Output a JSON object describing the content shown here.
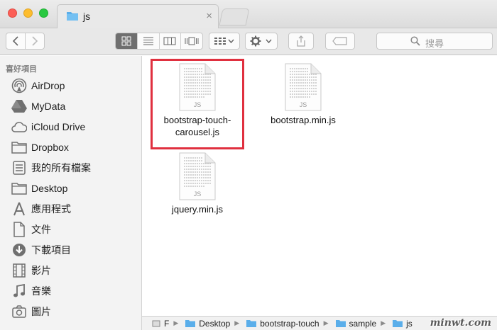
{
  "window": {
    "tab_title": "js",
    "tab_close": "×"
  },
  "toolbar": {
    "search_placeholder": "搜尋"
  },
  "sidebar": {
    "header": "喜好項目",
    "items": [
      {
        "label": "AirDrop",
        "icon": "airdrop-icon"
      },
      {
        "label": "MyData",
        "icon": "drive-icon"
      },
      {
        "label": "iCloud Drive",
        "icon": "cloud-icon"
      },
      {
        "label": "Dropbox",
        "icon": "folder-icon"
      },
      {
        "label": "我的所有檔案",
        "icon": "all-files-icon"
      },
      {
        "label": "Desktop",
        "icon": "folder-icon"
      },
      {
        "label": "應用程式",
        "icon": "applications-icon"
      },
      {
        "label": "文件",
        "icon": "document-icon"
      },
      {
        "label": "下載項目",
        "icon": "download-icon"
      },
      {
        "label": "影片",
        "icon": "movies-icon"
      },
      {
        "label": "音樂",
        "icon": "music-icon"
      },
      {
        "label": "圖片",
        "icon": "camera-icon"
      }
    ]
  },
  "files": [
    {
      "name_line1": "bootstrap-touch-",
      "name_line2": "carousel.js",
      "badge": "JS",
      "selected": true
    },
    {
      "name_line1": "bootstrap.min.js",
      "name_line2": "",
      "badge": "JS",
      "selected": false
    },
    {
      "name_line1": "jquery.min.js",
      "name_line2": "",
      "badge": "JS",
      "selected": false
    }
  ],
  "pathbar": {
    "items": [
      "F",
      "Desktop",
      "bootstrap-touch",
      "sample",
      "js"
    ]
  },
  "watermark": "minwt.com",
  "colors": {
    "highlight": "#e0303f",
    "folder": "#5aaeea",
    "selected_view": "#6f6f6f"
  }
}
